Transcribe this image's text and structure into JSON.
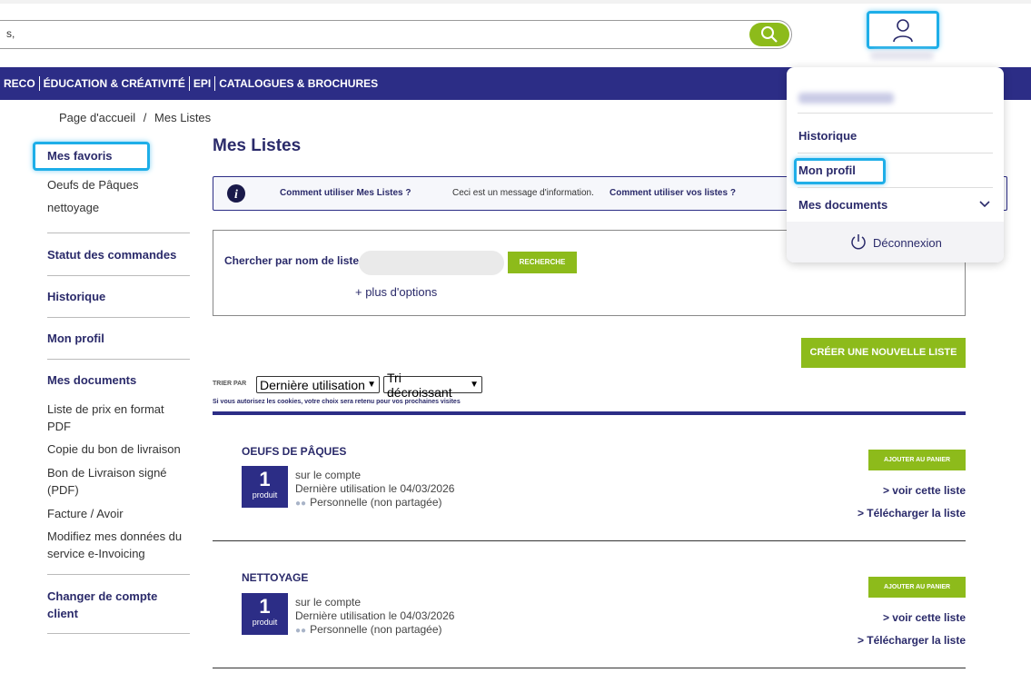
{
  "search": {
    "value": "s,"
  },
  "nav": {
    "items": [
      "RECO",
      "ÉDUCATION & CRÉATIVITÉ",
      "EPI",
      "CATALOGUES & BROCHURES"
    ]
  },
  "breadcrumb": {
    "home": "Page d'accueil",
    "sep": "/",
    "current": "Mes Listes"
  },
  "sidebar": {
    "favorites": "Mes favoris",
    "lists": [
      "Oeufs de Pâques",
      "nettoyage"
    ],
    "orders": "Statut des commandes",
    "history": "Historique",
    "profile": "Mon profil",
    "documents": "Mes documents",
    "doc_links": [
      "Liste de prix en format PDF",
      "Copie du bon de livraison",
      "Bon de Livraison signé (PDF)",
      "Facture / Avoir",
      "Modifiez mes données du service e-Invoicing"
    ],
    "switch_client": "Changer de compte client"
  },
  "main": {
    "title": "Mes Listes",
    "info": {
      "link1": "Comment utiliser Mes Listes ?",
      "message": "Ceci est un message d'information.",
      "link2": "Comment utiliser vos listes ?"
    },
    "search_label": "Chercher par nom de liste",
    "search_button": "RECHERCHE",
    "more_options": "+ plus d'options",
    "create_button": "CRÉER UNE NOUVELLE LISTE",
    "sort_label": "TRIER PAR",
    "sort_by": "Dernière utilisation",
    "sort_order": "Tri décroissant",
    "cookie_note": "Si vous autorisez les cookies, votre choix sera retenu pour vos prochaines visites",
    "lists": [
      {
        "name": "OEUFS DE PÂQUES",
        "count": "1",
        "unit": "produit",
        "account": "sur le compte",
        "last_used": "Dernière utilisation le 04/03/2026",
        "sharing": "Personnelle (non partagée)",
        "add_cart": "AJOUTER AU PANIER",
        "view": "> voir cette liste",
        "download": "> Télécharger la liste"
      },
      {
        "name": "NETTOYAGE",
        "count": "1",
        "unit": "produit",
        "account": "sur le compte",
        "last_used": "Dernière utilisation le 04/03/2026",
        "sharing": "Personnelle (non partagée)",
        "add_cart": "AJOUTER AU PANIER",
        "view": "> voir cette liste",
        "download": "> Télécharger la liste"
      }
    ]
  },
  "account_menu": {
    "history": "Historique",
    "profile": "Mon profil",
    "documents": "Mes documents",
    "logout": "Déconnexion"
  },
  "colors": {
    "navy": "#2c2d86",
    "green": "#8dbb1b",
    "highlight": "#1eaee8"
  }
}
